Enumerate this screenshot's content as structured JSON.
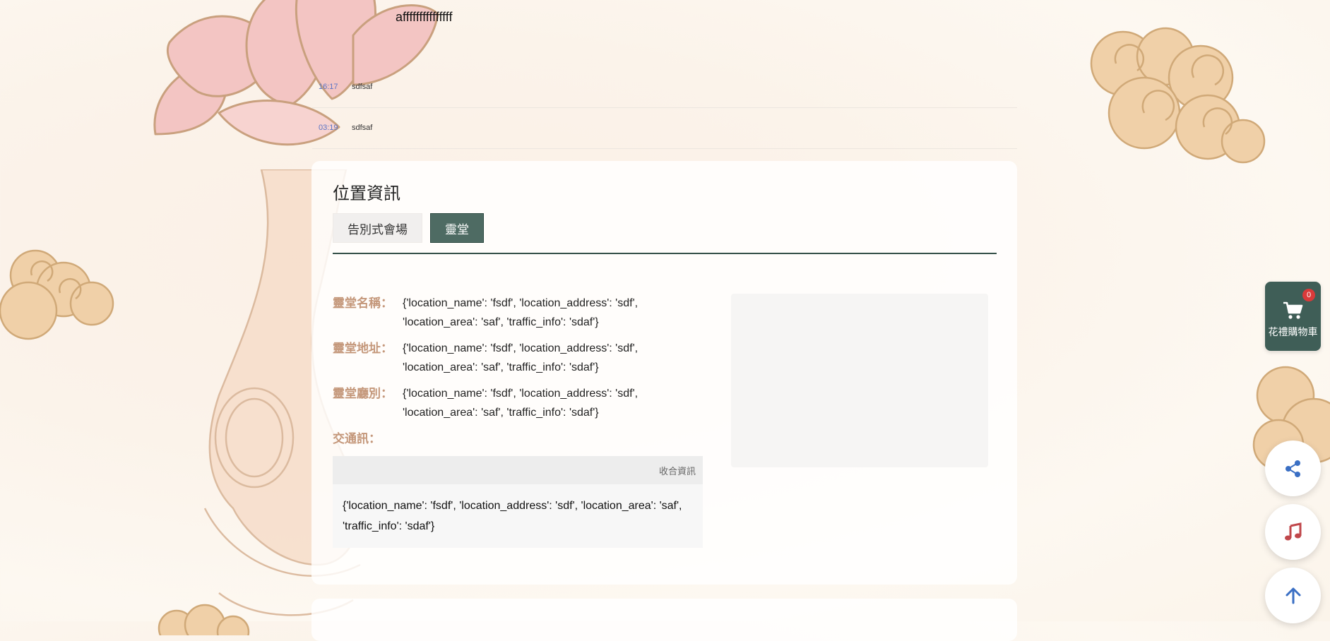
{
  "page": {
    "heading": "afffffffffffffff"
  },
  "messages": [
    {
      "time": "16:17",
      "text": "sdfsaf"
    },
    {
      "time": "03:19",
      "text": "sdfsaf"
    }
  ],
  "location": {
    "title": "位置資訊",
    "tabs": [
      {
        "label": "告別式會場",
        "active": false
      },
      {
        "label": "靈堂",
        "active": true
      }
    ],
    "fields": [
      {
        "label": "靈堂名稱：",
        "value": "{'location_name': 'fsdf', 'location_address': 'sdf', 'location_area': 'saf', 'traffic_info': 'sdaf'}"
      },
      {
        "label": "靈堂地址：",
        "value": "{'location_name': 'fsdf', 'location_address': 'sdf', 'location_area': 'saf', 'traffic_info': 'sdaf'}"
      },
      {
        "label": "靈堂廳別：",
        "value": "{'location_name': 'fsdf', 'location_address': 'sdf', 'location_area': 'saf', 'traffic_info': 'sdaf'}"
      }
    ],
    "traffic_label": "交通訊：",
    "collapse_label": "收合資訊",
    "traffic_value": "{'location_name': 'fsdf', 'location_address': 'sdf', 'location_area': 'saf', 'traffic_info': 'sdaf'}"
  },
  "cart": {
    "label": "花禮購物車",
    "count": "0",
    "icon": "shopping-cart-icon"
  },
  "floating_buttons": [
    {
      "name": "share",
      "icon": "share-icon",
      "color": "#3a6fc4"
    },
    {
      "name": "music",
      "icon": "music-note-icon",
      "color": "#c0474b"
    },
    {
      "name": "back-to-top",
      "icon": "arrow-up-icon",
      "color": "#3a6fc4"
    }
  ]
}
